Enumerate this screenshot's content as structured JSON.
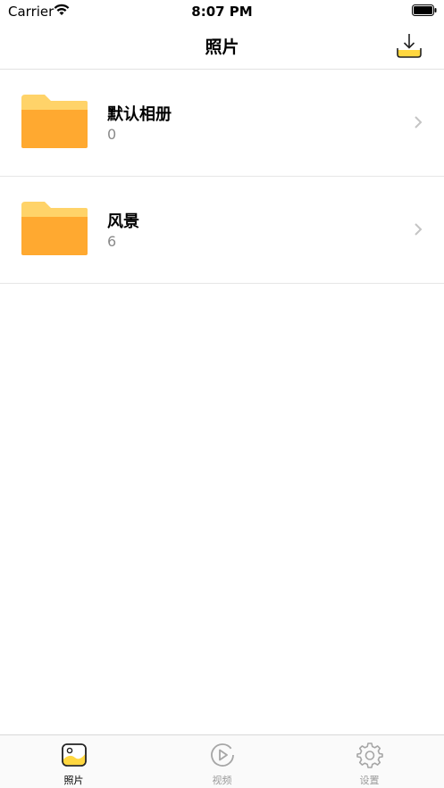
{
  "status_bar": {
    "carrier": "Carrier",
    "time": "8:07 PM"
  },
  "nav": {
    "title": "照片",
    "download_icon": "download-icon"
  },
  "albums": [
    {
      "name": "默认相册",
      "count": "0",
      "icon": "folder-icon"
    },
    {
      "name": "风景",
      "count": "6",
      "icon": "folder-icon"
    }
  ],
  "tab_bar": {
    "tabs": [
      {
        "label": "照片",
        "icon": "photo-icon",
        "active": true
      },
      {
        "label": "视频",
        "icon": "play-icon",
        "active": false
      },
      {
        "label": "设置",
        "icon": "gear-icon",
        "active": false
      }
    ]
  },
  "colors": {
    "accent": "#FFD740",
    "folder_front": "#FFA930",
    "folder_back": "#FFD369"
  }
}
